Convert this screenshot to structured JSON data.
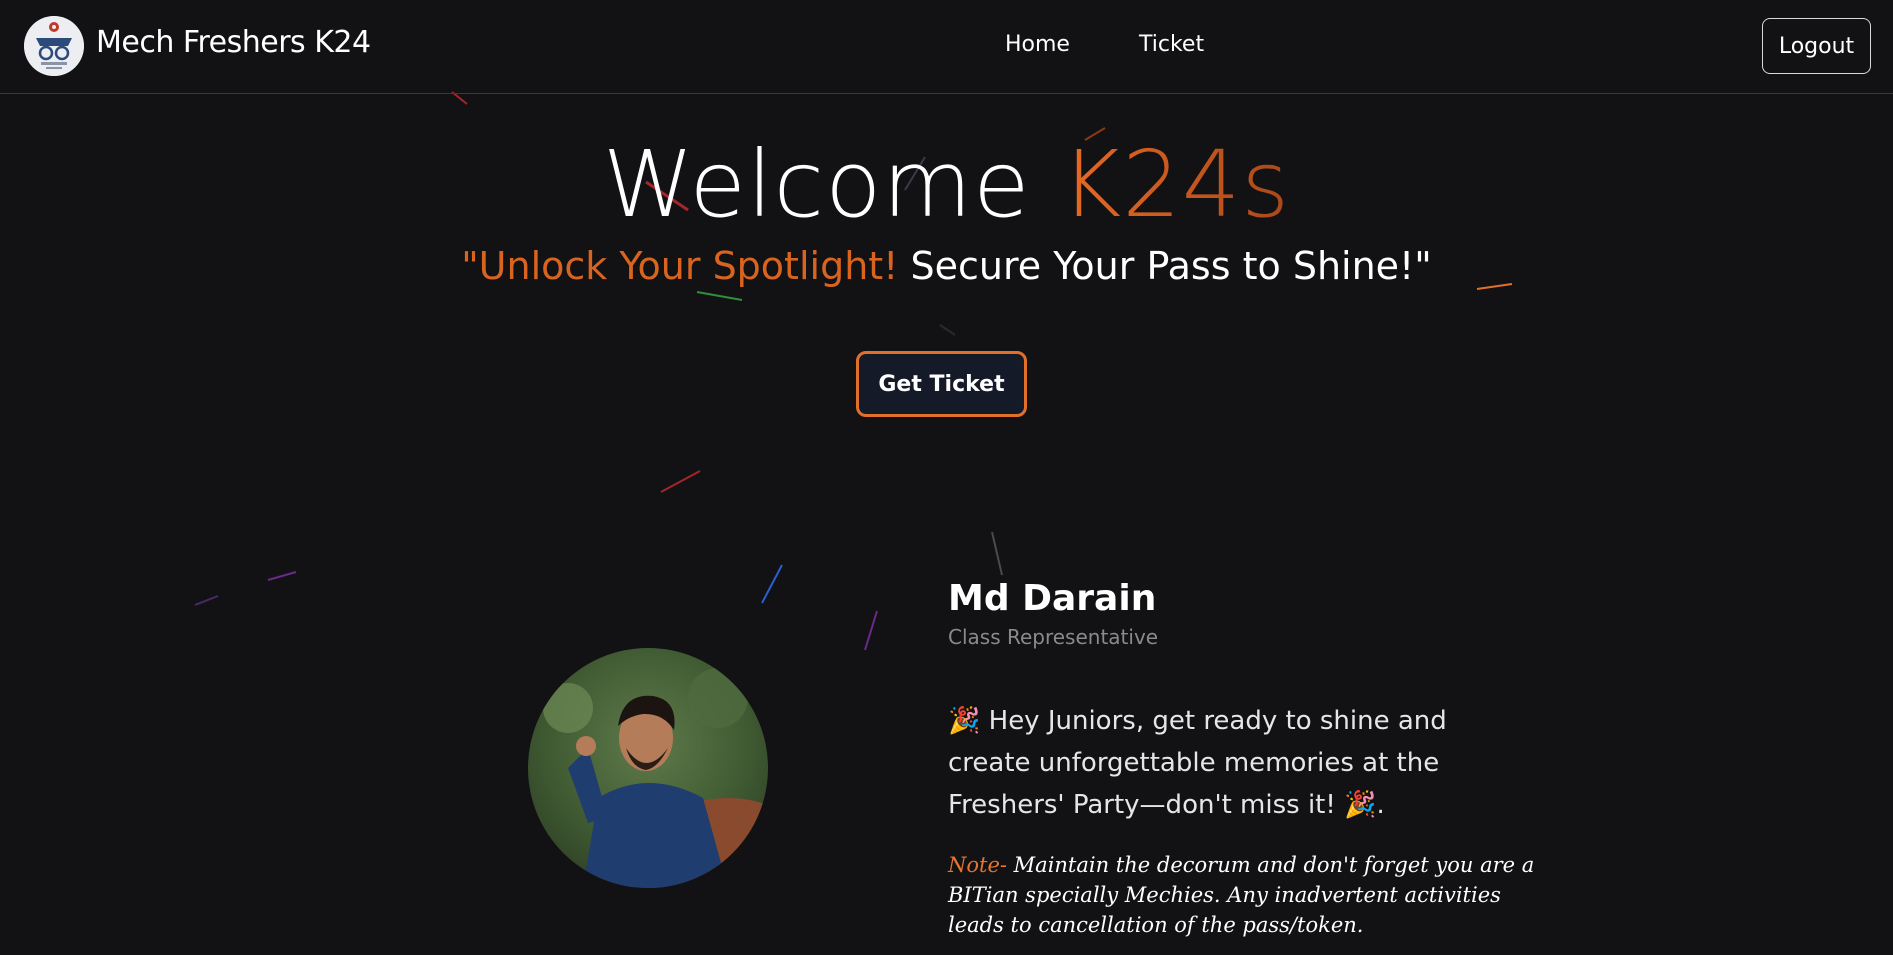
{
  "nav": {
    "brand": "Mech Freshers K24",
    "links": [
      "Home",
      "Ticket"
    ],
    "logout_label": "Logout"
  },
  "hero": {
    "title_main": "Welcome",
    "title_accent": "K24s",
    "tagline_accent": "\"Unlock Your Spotlight!",
    "tagline_rest": "Secure Your Pass to Shine!\"",
    "cta_label": "Get Ticket"
  },
  "profile": {
    "name": "Md Darain",
    "role": "Class Representative",
    "message": "🎉 Hey Juniors, get ready to shine and create unforgettable memories at the Freshers' Party—don't miss it! 🎉.",
    "note_label": "Note-",
    "note_text": "Maintain the decorum and don't forget you are a BITian specially Mechies. Any inadvertent activities leads to cancellation of the pass/token."
  },
  "colors": {
    "background": "#121214",
    "accent": "#e0702a",
    "muted": "#8a8a8e"
  }
}
